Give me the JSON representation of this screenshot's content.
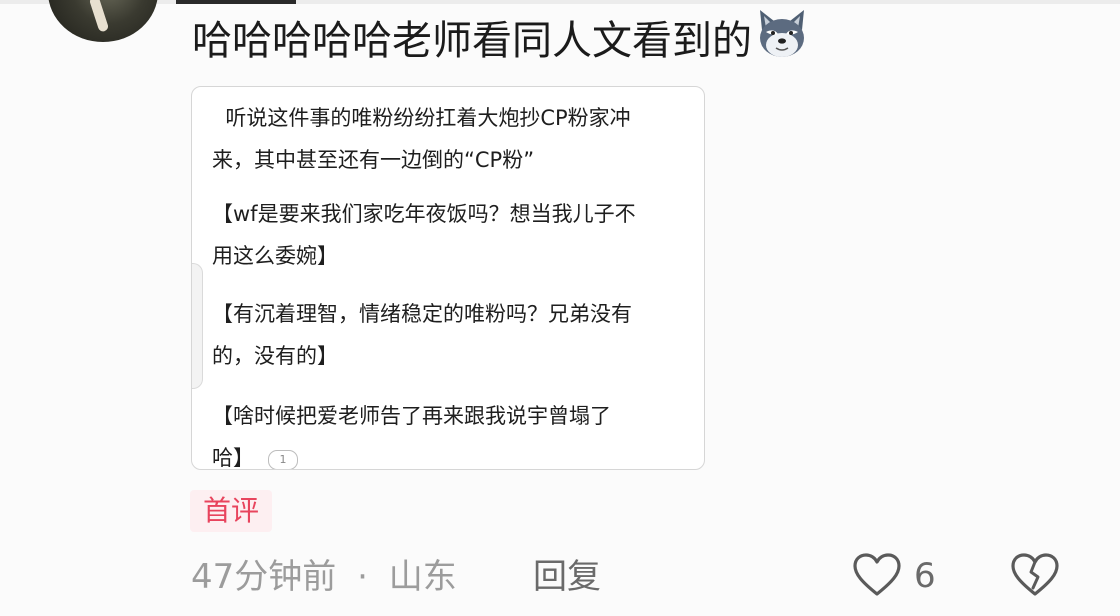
{
  "comment": {
    "text": "哈哈哈哈哈老师看同人文看到的",
    "emoji": "wolf-dog-emoji",
    "image_card": {
      "paragraphs": [
        "  听说这件事的唯粉纷纷扛着大炮抄CP粉家冲\n来，其中甚至还有一边倒的“CP粉”",
        "【wf是要来我们家吃年夜饭吗？想当我儿子不\n用这么委婉】",
        "【有沉着理智，情绪稳定的唯粉吗？兄弟没有\n的，没有的】",
        "【啥时候把爱老师告了再来跟我说宇曾塌了\n哈】"
      ],
      "page_indicator": "1"
    },
    "first_badge": "首评",
    "time": "47分钟前",
    "separator": "·",
    "location": "山东",
    "reply_label": "回复",
    "like_count": "6"
  },
  "colors": {
    "badge_text": "#e8445d",
    "badge_bg": "#fdeff1",
    "meta_text": "#9c9c9c",
    "action_text": "#6a6a6a"
  }
}
